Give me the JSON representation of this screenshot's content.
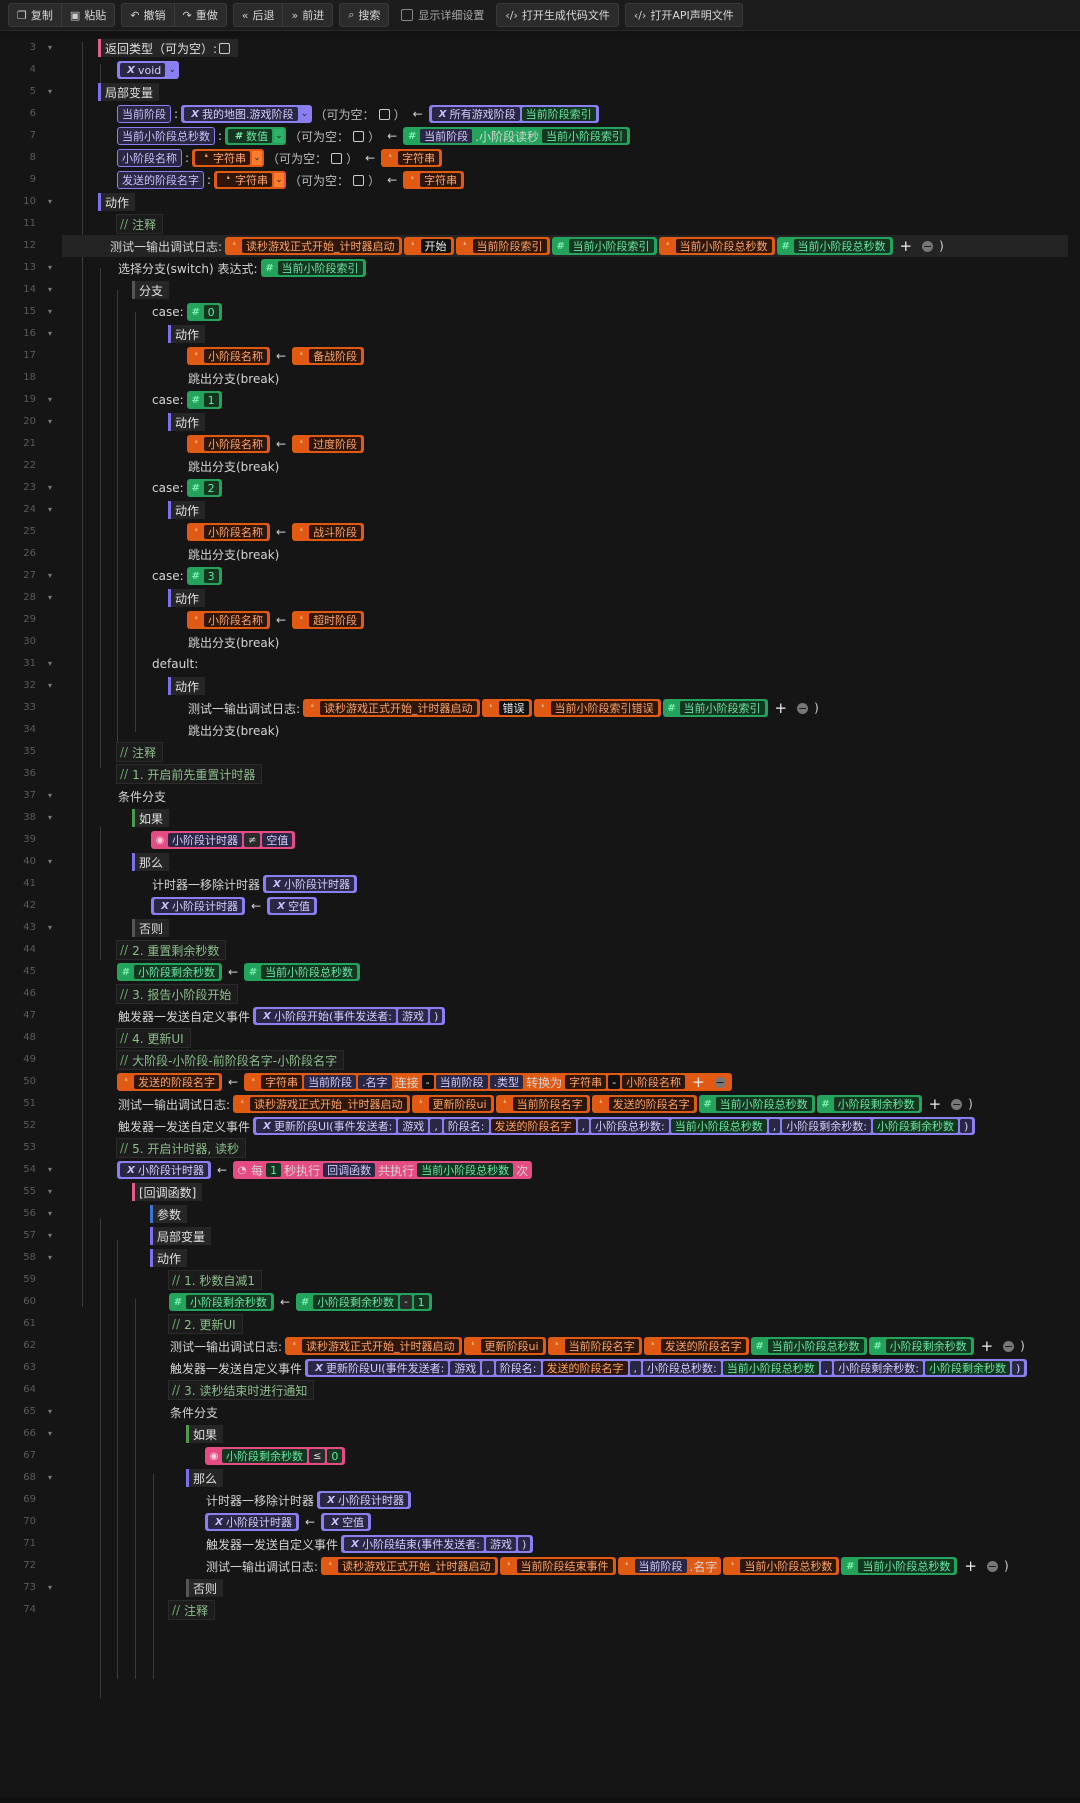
{
  "toolbar": {
    "copy": "复制",
    "paste": "粘贴",
    "undo": "撤销",
    "redo": "重做",
    "back": "后退",
    "forward": "前进",
    "search": "搜索",
    "show_details": "显示详细设置",
    "open_gen_code": "打开生成代码文件",
    "open_api": "打开API声明文件"
  },
  "lines": [
    "3",
    "4",
    "5",
    "6",
    "7",
    "8",
    "9",
    "10",
    "11",
    "12",
    "13",
    "14",
    "15",
    "16",
    "17",
    "18",
    "19",
    "20",
    "21",
    "22",
    "23",
    "24",
    "25",
    "26",
    "27",
    "28",
    "29",
    "30",
    "31",
    "32",
    "33",
    "34",
    "35",
    "36",
    "37",
    "38",
    "39",
    "40",
    "41",
    "42",
    "43",
    "44",
    "45",
    "46",
    "47",
    "48",
    "49",
    "50",
    "51",
    "52",
    "53",
    "54",
    "55",
    "56",
    "57",
    "58",
    "59",
    "60",
    "61",
    "62",
    "63",
    "64",
    "65",
    "66",
    "67",
    "68",
    "69",
    "70",
    "71",
    "72",
    "73",
    "74"
  ],
  "code": {
    "return_type": "返回类型（可为空）:",
    "void": "void",
    "local_vars": "局部变量",
    "cur_stage": "当前阶段",
    "map_stage_type": "我的地图.游戏阶段",
    "nullable": "（可为空：",
    "nullable_close": "）",
    "all_stages": "所有游戏阶段",
    "cur_stage_index": "当前阶段索引",
    "cur_sub_total": "当前小阶段总秒数",
    "number": "数值",
    "sub_read_sec": ".小阶段读秒",
    "cur_sub_index": "当前小阶段索引",
    "sub_name": "小阶段名称",
    "string": "字符串",
    "sent_stage_name": "发送的阶段名字",
    "action": "动作",
    "comment": "注释",
    "log": "测试一输出调试日志:",
    "log_tag": "读秒游戏正式开始_计时器启动",
    "start": "开始",
    "switch": "选择分支(switch) 表达式:",
    "branch": "分支",
    "case": "case:",
    "c0": "0",
    "c1": "1",
    "c2": "2",
    "c3": "3",
    "s0": "备战阶段",
    "s1": "过度阶段",
    "s2": "战斗阶段",
    "s3": "超时阶段",
    "break": "跳出分支(break)",
    "default": "default:",
    "error": "错误",
    "index_error": "当前小阶段索引错误",
    "cm1": "1. 开启前先重置计时器",
    "cond": "条件分支",
    "if": "如果",
    "sub_timer": "小阶段计时器",
    "neq": "≠",
    "null": "空值",
    "then": "那么",
    "remove_timer": "计时器一移除计时器",
    "else": "否则",
    "cm2": "2. 重置剩余秒数",
    "sub_remain": "小阶段剩余秒数",
    "cm3": "3. 报告小阶段开始",
    "trigger": "触发器一发送自定义事件",
    "sub_start": "小阶段开始(事件发送者:",
    "game": "游戏",
    "cm4": "4. 更新UI",
    "cm5": "大阶段-小阶段-前阶段名字-小阶段名字",
    "name": ".名字",
    "concat": "连接",
    "type": ".类型",
    "convert": "转换为",
    "dash": "-",
    "update_ui_log": "更新阶段ui",
    "cur_stage_name": "当前阶段名字",
    "update_ui": "更新阶段UI(事件发送者:",
    "p_stage_name": "阶段名:",
    "p_total": "小阶段总秒数:",
    "p_remain": "小阶段剩余秒数:",
    "cm6": "5. 开启计时器, 读秒",
    "every": "每",
    "one": "1",
    "sec_exec": "秒执行",
    "callback_fn": "回调函数",
    "total_exec": "共执行",
    "times": "次",
    "callback": "[回调函数]",
    "params": "参数",
    "cm7": "1. 秒数自减1",
    "minus": "-",
    "cm8": "2. 更新UI",
    "cm9": "3. 读秒结束时进行通知",
    "le": "≤",
    "zero": "0",
    "sub_end": "小阶段结束(事件发送者:",
    "stage_end_event": "当前阶段结束事件",
    "comma": ",",
    "close_paren": ")"
  },
  "colors": {
    "variable": "#8a7ff0",
    "number": "#23a35b",
    "string": "#e05a14",
    "condition": "#e44c83"
  }
}
